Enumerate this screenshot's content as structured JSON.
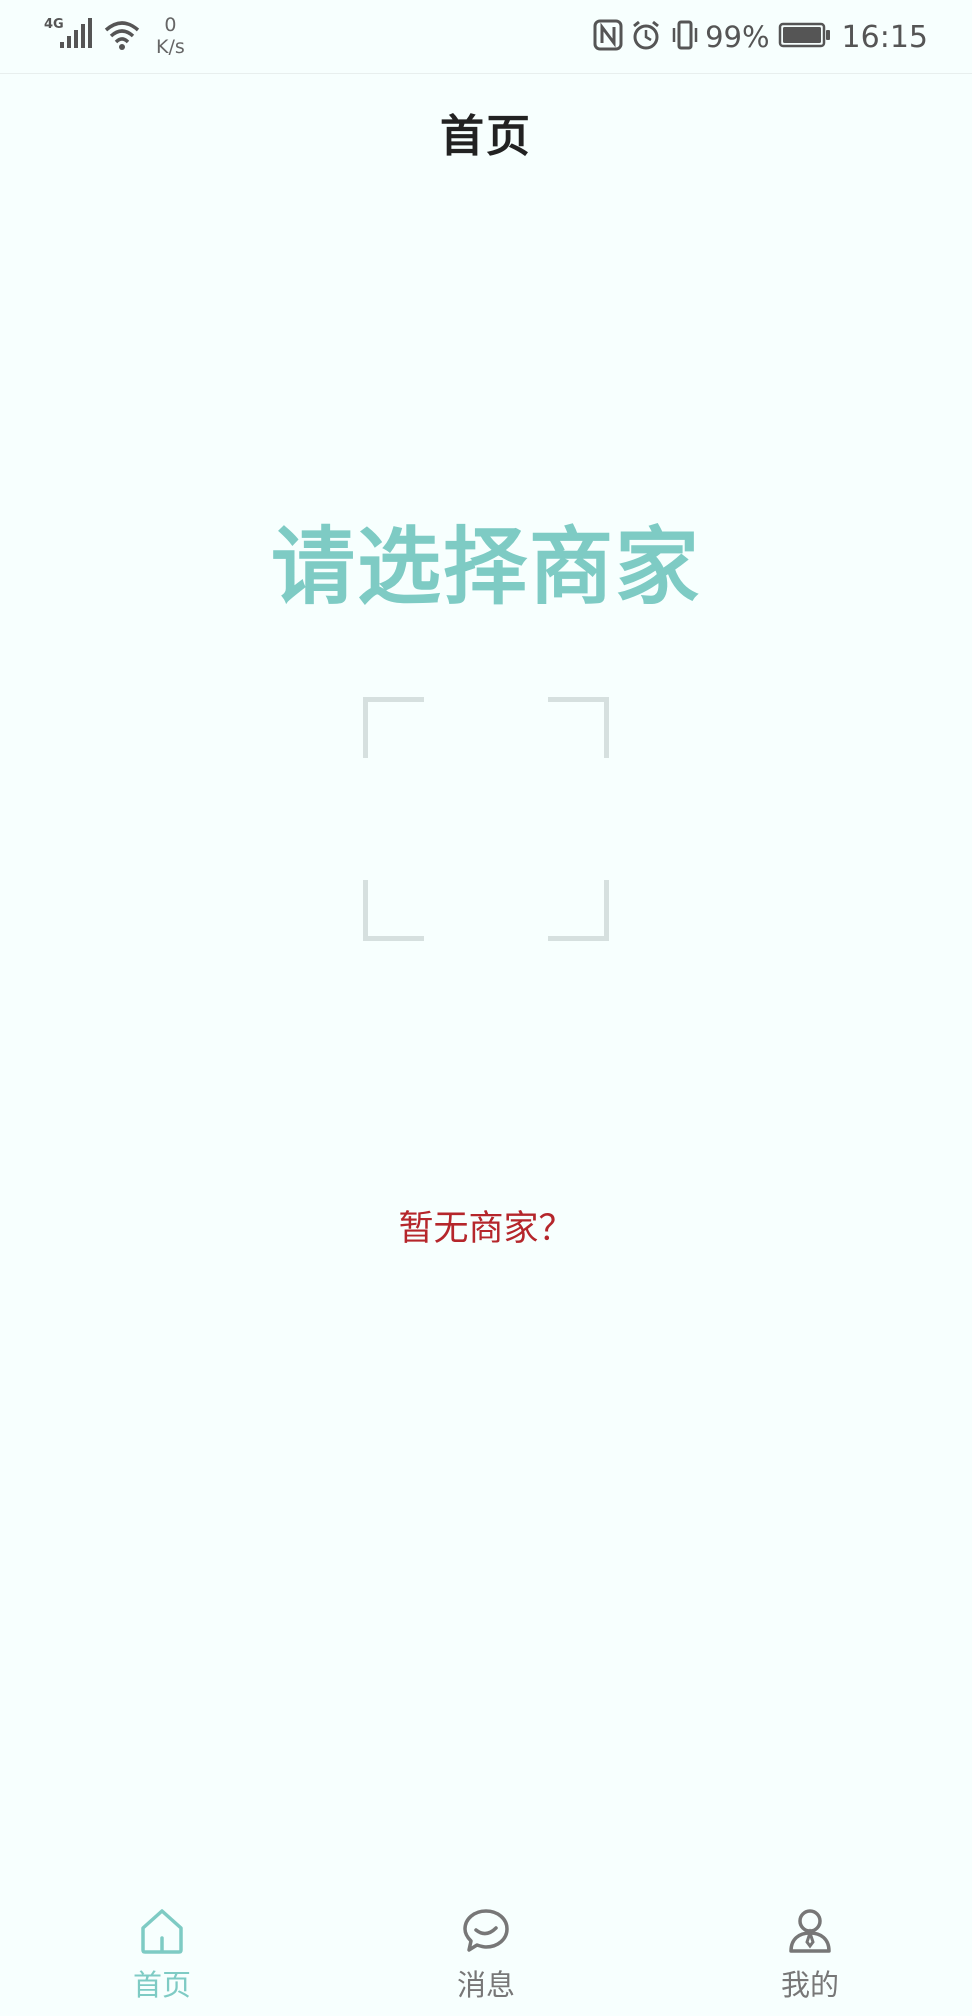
{
  "status_bar": {
    "network": "4G",
    "net_rate_value": "0",
    "net_rate_unit": "K/s",
    "battery_percent": "99%",
    "time": "16:15"
  },
  "header": {
    "title": "首页"
  },
  "main": {
    "heading": "请选择商家",
    "no_merchant_link": "暂无商家？"
  },
  "tab_bar": {
    "tabs": [
      {
        "label": "首页",
        "icon": "home-icon",
        "active": true
      },
      {
        "label": "消息",
        "icon": "chat-bubble-icon",
        "active": false
      },
      {
        "label": "我的",
        "icon": "user-icon",
        "active": false
      }
    ]
  },
  "colors": {
    "accent": "#7ecbc4",
    "link_red": "#b5262b",
    "background": "#f7fffe",
    "inactive_gray": "#777777"
  }
}
